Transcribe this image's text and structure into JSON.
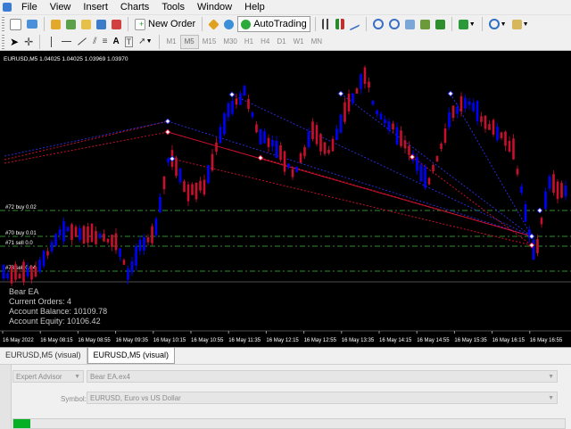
{
  "menu": [
    "File",
    "View",
    "Insert",
    "Charts",
    "Tools",
    "Window",
    "Help"
  ],
  "toolbar": {
    "new_order": "New Order",
    "autotrading": "AutoTrading"
  },
  "timeframes": [
    "M1",
    "M5",
    "M15",
    "M30",
    "H1",
    "H4",
    "D1",
    "W1",
    "MN"
  ],
  "active_timeframe": "M5",
  "chart": {
    "header": "EURUSD,M5  1.04025 1.04025 1.03969 1.03970",
    "order_labels": [
      "#72 buy 0.02",
      "#70 buy 0.01",
      "#71 sell 0.0",
      "#73 sell 0.04"
    ],
    "info": {
      "title": "Bear EA",
      "orders": "Current Orders:  4",
      "balance": "Account Balance:  10109.78",
      "equity": "Account Equity:  10106.42"
    },
    "time_labels": [
      "16 May 2022",
      "16 May 08:15",
      "16 May 08:55",
      "16 May 09:35",
      "16 May 10:15",
      "16 May 10:55",
      "16 May 11:35",
      "16 May 12:15",
      "16 May 12:55",
      "16 May 13:35",
      "16 May 14:15",
      "16 May 14:55",
      "16 May 15:35",
      "16 May 16:15",
      "16 May 16:55"
    ],
    "colors": {
      "background": "#000000",
      "bull": "#0000ff",
      "bear": "#c8102e",
      "level": "#2e8b2e",
      "text": "#ffffff"
    }
  },
  "tabs": [
    "EURUSD,M5 (visual)",
    "EURUSD,M5 (visual)"
  ],
  "tester": {
    "mode": "Expert Advisor",
    "expert": "Bear EA.ex4",
    "symbol_label": "Symbol:",
    "symbol": "EURUSD, Euro vs US Dollar",
    "progress": 0.03
  }
}
